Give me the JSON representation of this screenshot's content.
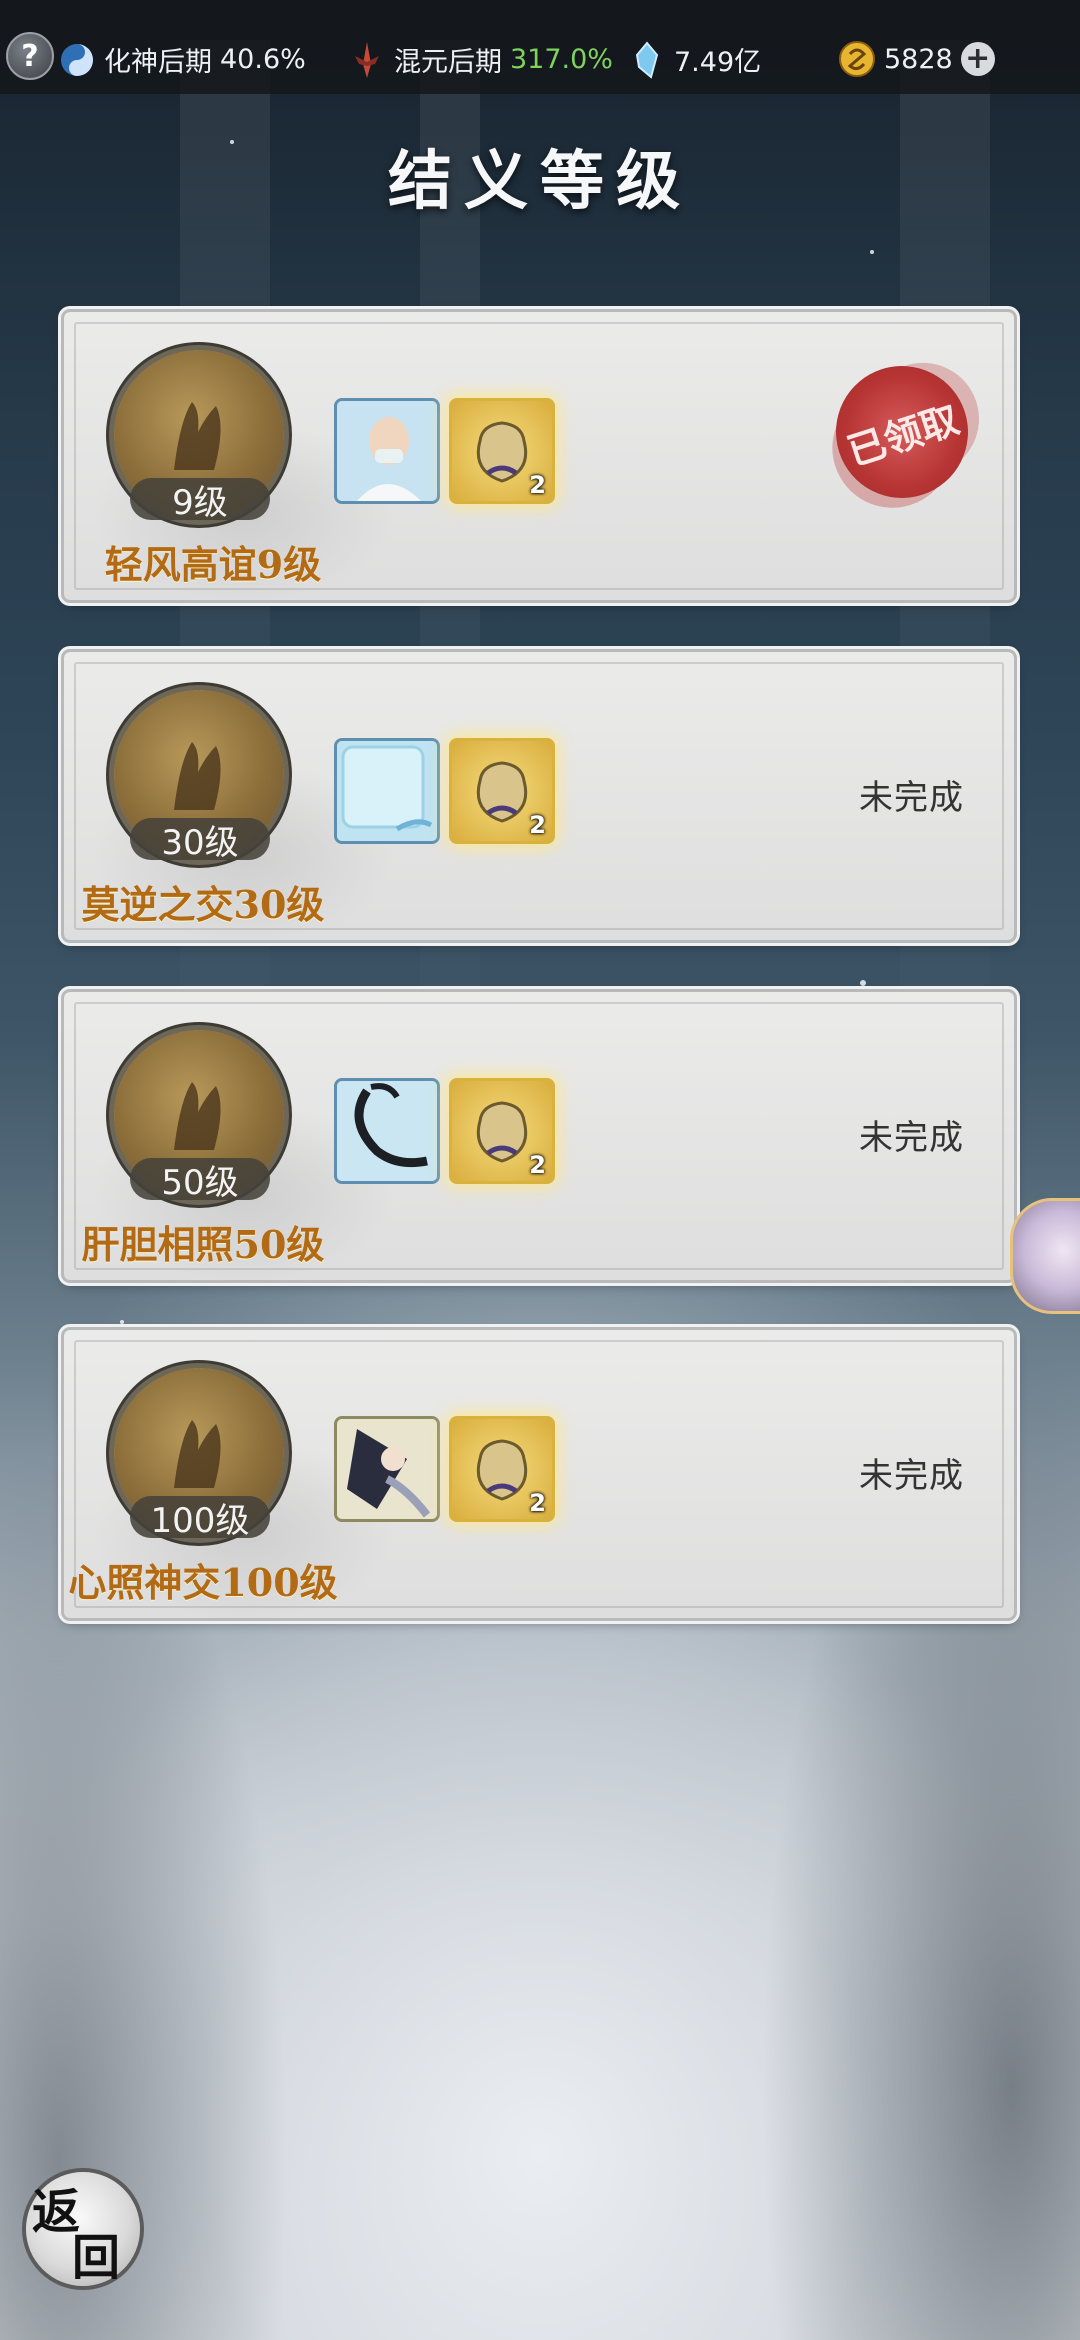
{
  "topbar": {
    "help": "?",
    "stat1_label": "化神后期",
    "stat1_value": "40.6%",
    "stat2_label": "混元后期",
    "stat2_value": "317.0%",
    "stat3_value": "7.49亿",
    "stat4_value": "5828",
    "plus": "+"
  },
  "page": {
    "title": "结义等级"
  },
  "cards": [
    {
      "level": "9级",
      "name": "轻风高谊9级",
      "reward_count": "2",
      "status": "已领取",
      "claimed": true
    },
    {
      "level": "30级",
      "name": "莫逆之交30级",
      "reward_count": "2",
      "status": "未完成",
      "claimed": false
    },
    {
      "level": "50级",
      "name": "肝胆相照50级",
      "reward_count": "2",
      "status": "未完成",
      "claimed": false
    },
    {
      "level": "100级",
      "name": "心照神交100级",
      "reward_count": "2",
      "status": "未完成",
      "claimed": false
    }
  ],
  "back_button": {
    "char1": "返",
    "char2": "回"
  },
  "icons": {
    "help": "question-icon",
    "stat1": "taiji-icon",
    "stat2": "sword-icon",
    "stat3": "spirit-crystal-icon",
    "stat4": "gold-coin-icon",
    "plus": "plus-icon"
  }
}
